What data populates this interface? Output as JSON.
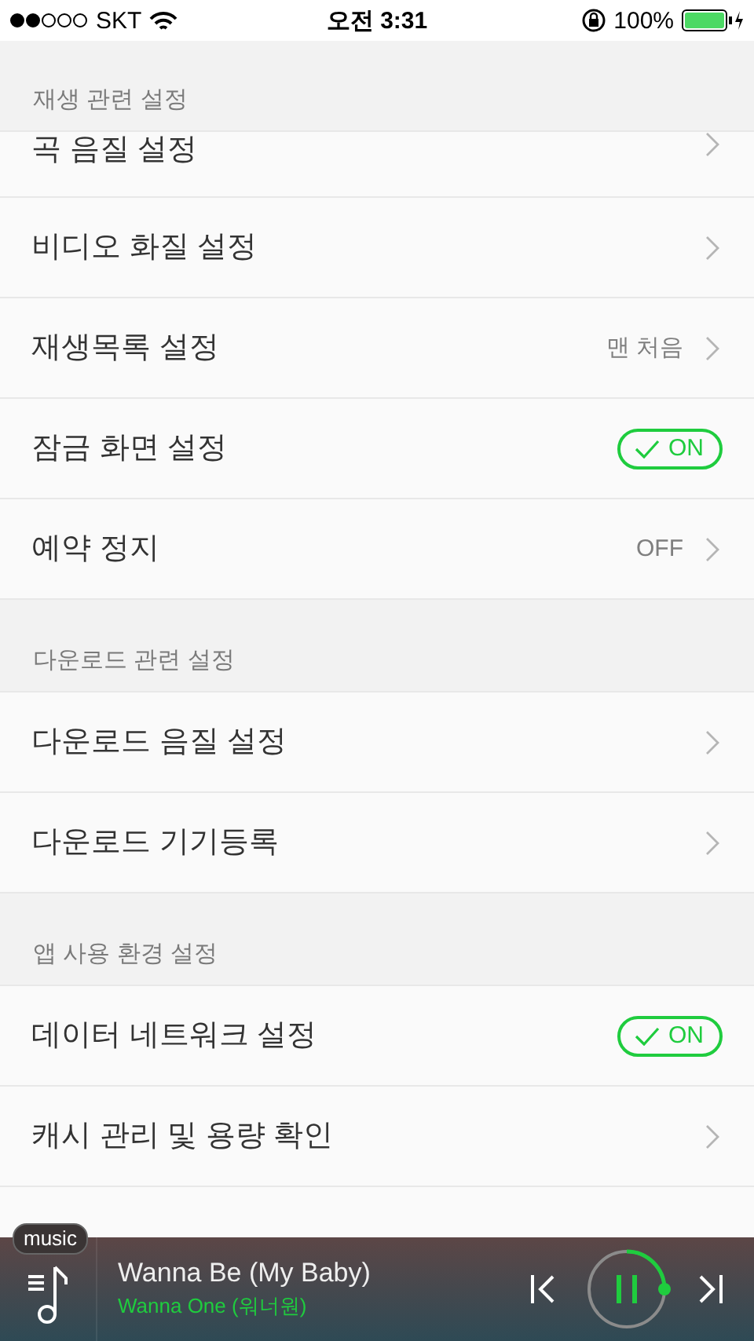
{
  "status_bar": {
    "carrier": "SKT",
    "time": "오전 3:31",
    "battery": "100%"
  },
  "sections": [
    {
      "title": "재생 관련 설정",
      "items": [
        {
          "kind": "chevron",
          "label": "곡 음질 설정"
        },
        {
          "kind": "chevron",
          "label": "비디오 화질 설정"
        },
        {
          "kind": "value",
          "label": "재생목록 설정",
          "value": "맨 처음"
        },
        {
          "kind": "toggle",
          "label": "잠금 화면 설정",
          "on": true,
          "toggle_text": "ON"
        },
        {
          "kind": "value",
          "label": "예약 정지",
          "value": "OFF"
        }
      ]
    },
    {
      "title": "다운로드 관련 설정",
      "items": [
        {
          "kind": "chevron",
          "label": "다운로드 음질 설정"
        },
        {
          "kind": "chevron",
          "label": "다운로드 기기등록"
        }
      ]
    },
    {
      "title": "앱 사용 환경 설정",
      "items": [
        {
          "kind": "toggle",
          "label": "데이터 네트워크 설정",
          "on": true,
          "toggle_text": "ON"
        },
        {
          "kind": "chevron",
          "label": "캐시 관리 및 용량 확인"
        }
      ]
    }
  ],
  "player": {
    "badge": "music",
    "title": "Wanna Be (My Baby)",
    "artist": "Wanna One (워너원)",
    "playing": true
  }
}
